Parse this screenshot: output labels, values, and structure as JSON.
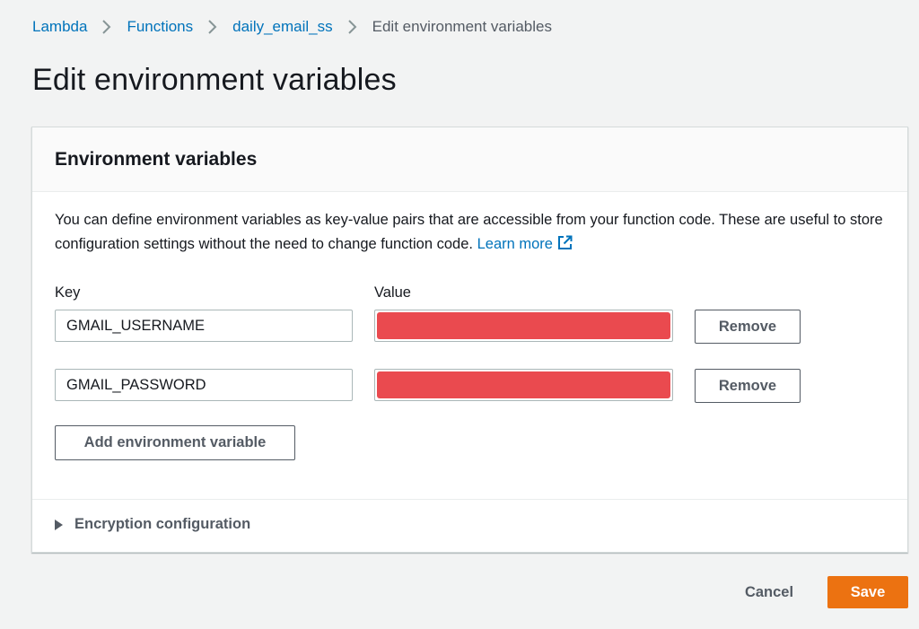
{
  "breadcrumb": {
    "items": [
      "Lambda",
      "Functions",
      "daily_email_ss"
    ],
    "current": "Edit environment variables",
    "separator_icon": "chevron-right-icon"
  },
  "page": {
    "title": "Edit environment variables"
  },
  "env_panel": {
    "title": "Environment variables",
    "description": "You can define environment variables as key-value pairs that are accessible from your function code. These are useful to store configuration settings without the need to change function code.",
    "learn_more_label": "Learn more",
    "learn_more_icon": "external-link-icon",
    "key_column_label": "Key",
    "value_column_label": "Value",
    "rows": [
      {
        "key": "GMAIL_USERNAME",
        "value_redacted": true,
        "remove_label": "Remove"
      },
      {
        "key": "GMAIL_PASSWORD",
        "value_redacted": true,
        "remove_label": "Remove"
      }
    ],
    "add_button_label": "Add environment variable",
    "encryption_label": "Encryption configuration",
    "encryption_expanded": false
  },
  "footer": {
    "cancel_label": "Cancel",
    "save_label": "Save"
  },
  "colors": {
    "background": "#f2f3f3",
    "link": "#0073bb",
    "primary_button": "#ec7211",
    "redaction": "#ea4a4f",
    "text": "#16191f",
    "secondary_text": "#545b64"
  }
}
